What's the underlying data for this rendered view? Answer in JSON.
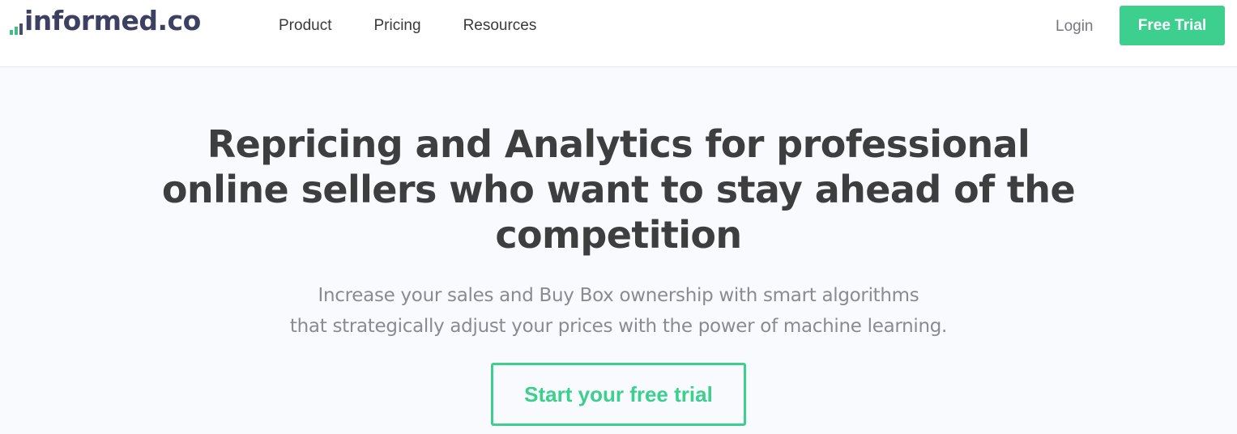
{
  "header": {
    "logo_text": "informed.co",
    "nav": [
      {
        "label": "Product"
      },
      {
        "label": "Pricing"
      },
      {
        "label": "Resources"
      }
    ],
    "login_label": "Login",
    "free_trial_label": "Free Trial"
  },
  "hero": {
    "title": "Repricing and Analytics for professional online sellers who want to stay ahead of the competition",
    "subtitle_line1": "Increase your sales and Buy Box ownership with smart algorithms",
    "subtitle_line2": "that strategically adjust your prices with the power of machine learning.",
    "cta_label": "Start your free trial"
  },
  "colors": {
    "accent": "#3ccf8e",
    "logo_dark": "#3d4063",
    "background": "#f9fafe"
  }
}
